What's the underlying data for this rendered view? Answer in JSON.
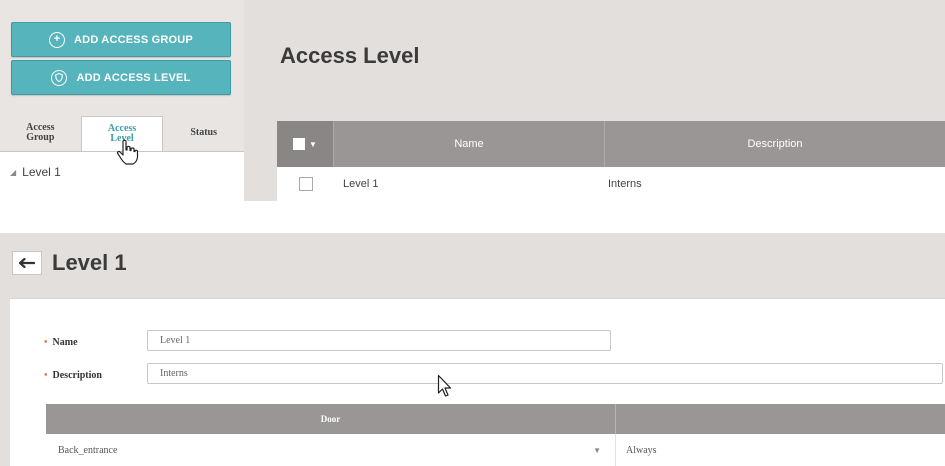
{
  "sidebar": {
    "add_group_label": "ADD ACCESS GROUP",
    "add_level_label": "ADD ACCESS LEVEL",
    "tabs": [
      {
        "label_line1": "Access",
        "label_line2": "Group"
      },
      {
        "label_line1": "Access",
        "label_line2": "Level"
      },
      {
        "label_line1": "Status",
        "label_line2": ""
      }
    ],
    "active_tab": "Access Level",
    "tree_items": [
      "Level 1"
    ]
  },
  "list_view": {
    "title": "Access Level",
    "columns": [
      "Name",
      "Description"
    ],
    "rows": [
      {
        "name": "Level 1",
        "description": "Interns"
      }
    ]
  },
  "detail_view": {
    "title": "Level 1",
    "fields": [
      {
        "label": "Name",
        "value": "Level 1"
      },
      {
        "label": "Description",
        "value": "Interns"
      }
    ],
    "door_table": {
      "columns": [
        "Door",
        ""
      ],
      "rows": [
        {
          "door": "Back_entrance",
          "schedule": "Always"
        }
      ]
    }
  },
  "colors": {
    "accent": "#56b4bd",
    "table_header": "#9a9696",
    "panel_bg": "#e3dfdd"
  }
}
